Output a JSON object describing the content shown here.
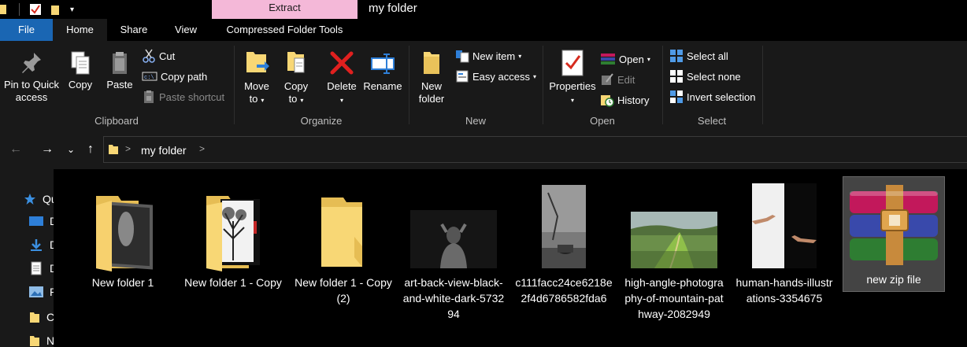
{
  "window": {
    "title": "my folder",
    "contextual_tab": "Extract"
  },
  "tabs": {
    "file": "File",
    "home": "Home",
    "share": "Share",
    "view": "View",
    "compressed": "Compressed Folder Tools"
  },
  "ribbon": {
    "clipboard": {
      "label": "Clipboard",
      "pin_line1": "Pin to Quick",
      "pin_line2": "access",
      "copy": "Copy",
      "paste": "Paste",
      "cut": "Cut",
      "copy_path": "Copy path",
      "paste_shortcut": "Paste shortcut"
    },
    "organize": {
      "label": "Organize",
      "move_line1": "Move",
      "move_line2": "to",
      "copy_line1": "Copy",
      "copy_line2": "to",
      "delete": "Delete",
      "rename": "Rename"
    },
    "new": {
      "label": "New",
      "folder_line1": "New",
      "folder_line2": "folder",
      "new_item": "New item",
      "easy_access": "Easy access"
    },
    "open": {
      "label": "Open",
      "properties": "Properties",
      "open": "Open",
      "edit": "Edit",
      "history": "History"
    },
    "select": {
      "label": "Select",
      "select_all": "Select all",
      "select_none": "Select none",
      "invert": "Invert selection"
    }
  },
  "address": {
    "crumb": "my folder"
  },
  "navpane": {
    "items": [
      {
        "label": "Qu",
        "icon": "star-icon"
      },
      {
        "label": "D",
        "icon": "desktop-icon"
      },
      {
        "label": "D",
        "icon": "download-icon"
      },
      {
        "label": "D",
        "icon": "document-icon"
      },
      {
        "label": "P",
        "icon": "pictures-icon"
      },
      {
        "label": "C",
        "icon": "folder-icon"
      },
      {
        "label": "N",
        "icon": "folder-icon"
      }
    ]
  },
  "files": [
    {
      "name": "New folder 1",
      "type": "folder-photo"
    },
    {
      "name": "New folder 1 - Copy",
      "type": "folder-tree"
    },
    {
      "name": "New folder 1 - Copy (2)",
      "type": "folder-empty"
    },
    {
      "name": "art-back-view-black-and-white-dark-573294",
      "type": "image-dark"
    },
    {
      "name": "c111facc24ce6218e2f4d6786582fda6",
      "type": "image-bw"
    },
    {
      "name": "high-angle-photography-of-mountain-pathway-2082949",
      "type": "image-landscape"
    },
    {
      "name": "human-hands-illustrations-3354675",
      "type": "image-hands"
    },
    {
      "name": "new zip file",
      "type": "zip-archive"
    }
  ],
  "colors": {
    "accent": "#1a66b3",
    "contextual": "#f4b8d8",
    "folder": "#f8d775",
    "selection": "#444444"
  }
}
